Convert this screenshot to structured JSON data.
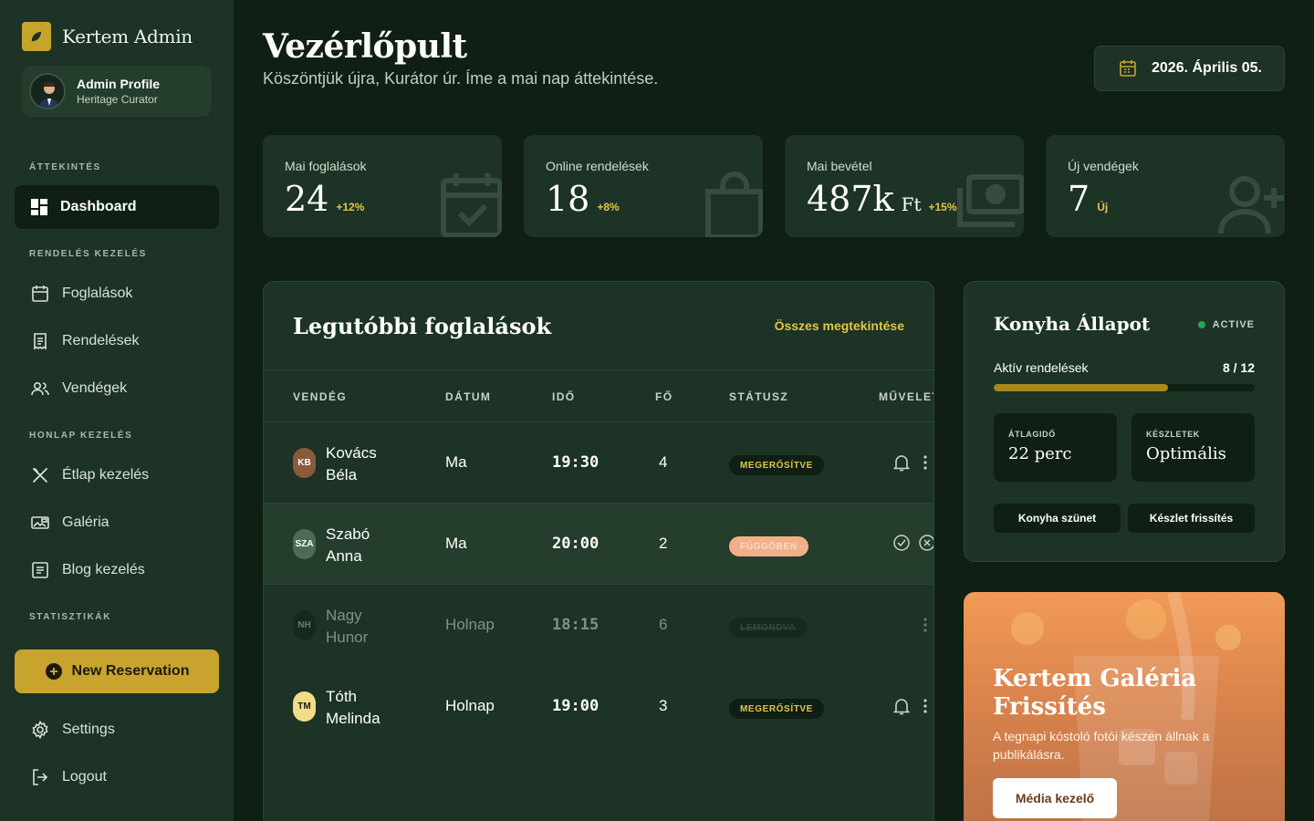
{
  "brand": {
    "name": "Kertem Admin"
  },
  "profile": {
    "name": "Admin Profile",
    "role": "Heritage Curator"
  },
  "sidebar": {
    "sections": [
      "ÁTTEKINTÉS",
      "RENDELÉS KEZELÉS",
      "HONLAP KEZELÉS",
      "STATISZTIKÁK"
    ],
    "items": [
      {
        "label": "Dashboard",
        "icon": "dashboard-icon"
      },
      {
        "label": "Foglalások",
        "icon": "calendar-icon"
      },
      {
        "label": "Rendelések",
        "icon": "receipt-icon"
      },
      {
        "label": "Vendégek",
        "icon": "users-icon"
      },
      {
        "label": "Étlap kezelés",
        "icon": "utensils-icon"
      },
      {
        "label": "Galéria",
        "icon": "gallery-icon"
      },
      {
        "label": "Blog kezelés",
        "icon": "article-icon"
      }
    ],
    "new_reservation": "New Reservation",
    "settings": "Settings",
    "logout": "Logout"
  },
  "header": {
    "title": "Vezérlőpult",
    "subtitle": "Köszöntjük újra, Kurátor úr. Íme a mai nap áttekintése.",
    "date": "2026. Április 05."
  },
  "stats": [
    {
      "label": "Mai foglalások",
      "value": "24",
      "unit": "",
      "delta": "+12%"
    },
    {
      "label": "Online rendelések",
      "value": "18",
      "unit": "",
      "delta": "+8%"
    },
    {
      "label": "Mai bevétel",
      "value": "487k",
      "unit": "Ft",
      "delta": "+15%"
    },
    {
      "label": "Új vendégek",
      "value": "7",
      "unit": "",
      "delta": "Új"
    }
  ],
  "bookings": {
    "title": "Legutóbbi foglalások",
    "view_all": "Összes megtekintése",
    "columns": [
      "VENDÉG",
      "DÁTUM",
      "IDŐ",
      "FŐ",
      "STÁTUSZ",
      "MŰVELET"
    ],
    "rows": [
      {
        "initials": "KB",
        "first": "Kovács",
        "last": "Béla",
        "date": "Ma",
        "time": "19:30",
        "guests": "4",
        "status": "MEGERŐSÍTVE"
      },
      {
        "initials": "SZA",
        "first": "Szabó",
        "last": "Anna",
        "date": "Ma",
        "time": "20:00",
        "guests": "2",
        "status": "FÜGGŐBEN"
      },
      {
        "initials": "NH",
        "first": "Nagy",
        "last": "Hunor",
        "date": "Holnap",
        "time": "18:15",
        "guests": "6",
        "status": "LEMONDVA"
      },
      {
        "initials": "TM",
        "first": "Tóth",
        "last": "Melinda",
        "date": "Holnap",
        "time": "19:00",
        "guests": "3",
        "status": "MEGERŐSÍTVE"
      }
    ]
  },
  "kitchen": {
    "title": "Konyha Állapot",
    "status": "ACTIVE",
    "progress_label": "Aktív rendelések",
    "progress_value": "8 / 12",
    "progress_fraction": 0.667,
    "avg_label": "ÁTLAGIDŐ",
    "avg_value": "22 perc",
    "stock_label": "KÉSZLETEK",
    "stock_value": "Optimális",
    "pause_button": "Konyha szünet",
    "refresh_button": "Készlet frissítés"
  },
  "promo": {
    "title": "Kertem Galéria Frissítés",
    "text": "A tegnapi kóstoló fotói készen állnak a publikálásra.",
    "button": "Média kezelő"
  },
  "colors": {
    "accent": "#c8a42e",
    "sidebar": "#1c3325",
    "background": "#0f1f14",
    "pending": "#f2b08a"
  }
}
